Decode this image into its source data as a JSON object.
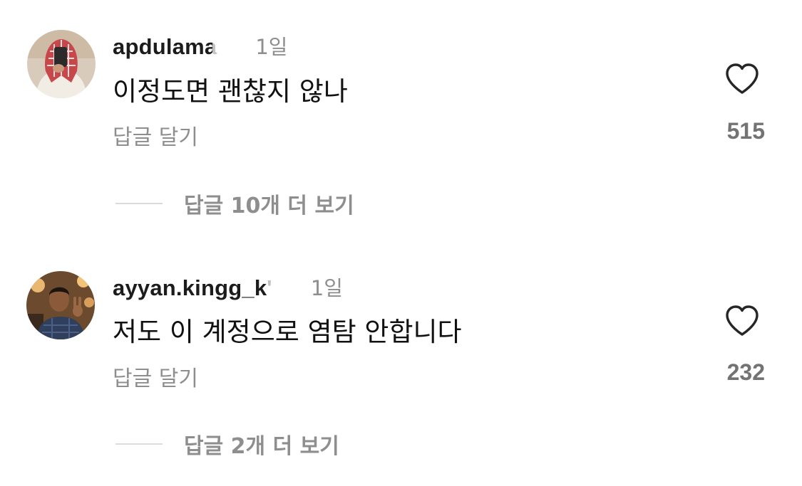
{
  "comments": [
    {
      "username": "apdulama",
      "time": "1일",
      "text": "이정도면 괜찮지 않나",
      "reply_label": "답글 달기",
      "like_count": "515",
      "more_replies_label": "답글 10개 더 보기",
      "avatar_icon": "avatar-keffiyeh-person"
    },
    {
      "username": "ayyan.kingg_k'",
      "time": "1일",
      "text": "저도 이 계정으로 염탐 안합니다",
      "reply_label": "답글 달기",
      "like_count": "232",
      "more_replies_label": "답글 2개 더 보기",
      "avatar_icon": "avatar-peace-sign-person"
    }
  ],
  "colors": {
    "secondary_text": "#8e8e8e",
    "like_count": "#737373",
    "divider": "#dbdbdb",
    "heart_outline": "#262626"
  }
}
